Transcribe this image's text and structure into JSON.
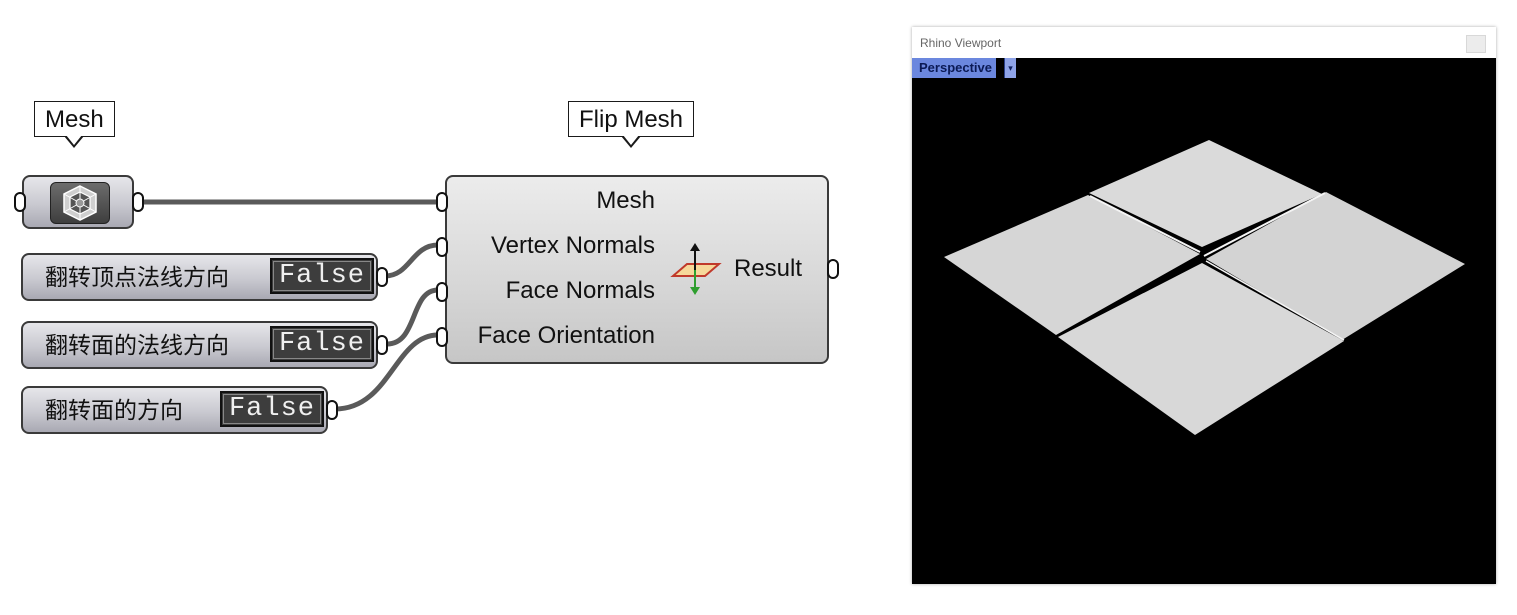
{
  "grasshopper": {
    "mesh_callout": "Mesh",
    "flip_callout": "Flip Mesh",
    "toggles": [
      {
        "label": "翻转顶点法线方向",
        "value": "False"
      },
      {
        "label": "翻转面的法线方向",
        "value": "False"
      },
      {
        "label": "翻转面的方向",
        "value": "False"
      }
    ],
    "flip_component": {
      "inputs": [
        "Mesh",
        "Vertex Normals",
        "Face Normals",
        "Face Orientation"
      ],
      "output": "Result",
      "icon": "flip-mesh-icon"
    },
    "mesh_param_icon": "mesh-param-icon"
  },
  "viewport": {
    "title": "Rhino Viewport",
    "view_name": "Perspective",
    "dropdown_icon": "dropdown-arrow-icon",
    "background": "#000000",
    "mesh_color": "#dcdcdc"
  }
}
